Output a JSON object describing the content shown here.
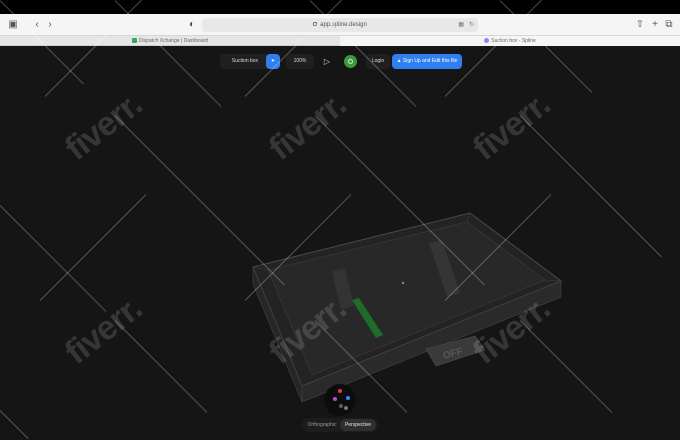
{
  "browser": {
    "url": "app.spline.design",
    "tabs": [
      {
        "label": "Dispatch Xchange | Dashboard",
        "active": false
      },
      {
        "label": "Suction box - Spline",
        "active": true
      }
    ]
  },
  "toolbar": {
    "scene_name": "Suction box",
    "zoom": "100%",
    "login_label": "Login",
    "signup_label": "Sign Up and Edit this file",
    "accent": "#2f7ff0"
  },
  "scene": {
    "object_label": "OFF"
  },
  "view_modes": [
    {
      "label": "Orthographic",
      "active": false
    },
    {
      "label": "Perspective",
      "active": true
    }
  ],
  "watermark": {
    "text": "fiverr."
  }
}
